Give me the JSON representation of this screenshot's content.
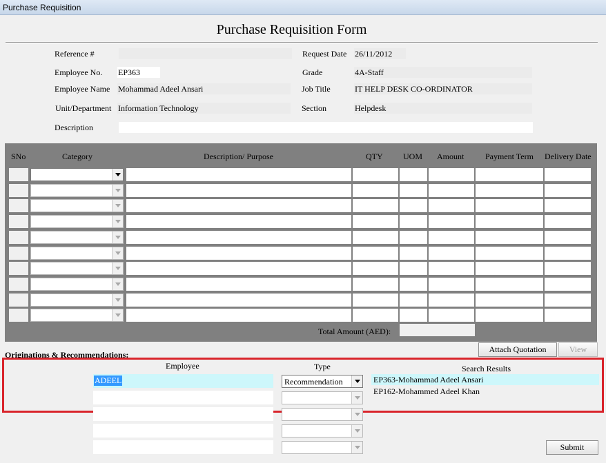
{
  "window": {
    "title": "Purchase Requisition"
  },
  "form": {
    "title": "Purchase Requisition Form"
  },
  "header": {
    "reference_label": "Reference #",
    "reference_value": "",
    "request_date_label": "Request Date",
    "request_date_value": "26/11/2012",
    "employee_no_label": "Employee No.",
    "employee_no_value": "EP363",
    "grade_label": "Grade",
    "grade_value": "4A-Staff",
    "employee_name_label": "Employee Name",
    "employee_name_value": "Mohammad Adeel Ansari",
    "job_title_label": "Job Title",
    "job_title_value": "IT HELP DESK CO-ORDINATOR",
    "unit_label": "Unit/Department",
    "unit_value": "Information Technology",
    "section_label": "Section",
    "section_value": "Helpdesk",
    "description_label": "Description",
    "description_value": ""
  },
  "items_grid": {
    "columns": [
      "SNo",
      "Category",
      "Description/ Purpose",
      "QTY",
      "UOM",
      "Amount",
      "Payment Term",
      "Delivery Date"
    ],
    "row_count": 10,
    "total_label": "Total Amount (AED):",
    "total_value": ""
  },
  "originations": {
    "section_label": "Originations & Recommendations:",
    "attach_button": "Attach Quotation",
    "view_button": "View",
    "employee_header": "Employee",
    "type_header": "Type",
    "results_header": "Search Results",
    "employee_input": "ADEEL",
    "type_value": "Recommendation",
    "results": [
      "EP363-Mohammad Adeel Ansari",
      "EP162-Mohammed Adeel Khan"
    ]
  },
  "footer": {
    "submit_button": "Submit"
  },
  "colors": {
    "highlight": "#d9242b",
    "grid": "#808080",
    "selection": "#cdf7fb",
    "text_selection": "#3399ff"
  },
  "icons": [
    "dropdown-arrow-icon"
  ]
}
